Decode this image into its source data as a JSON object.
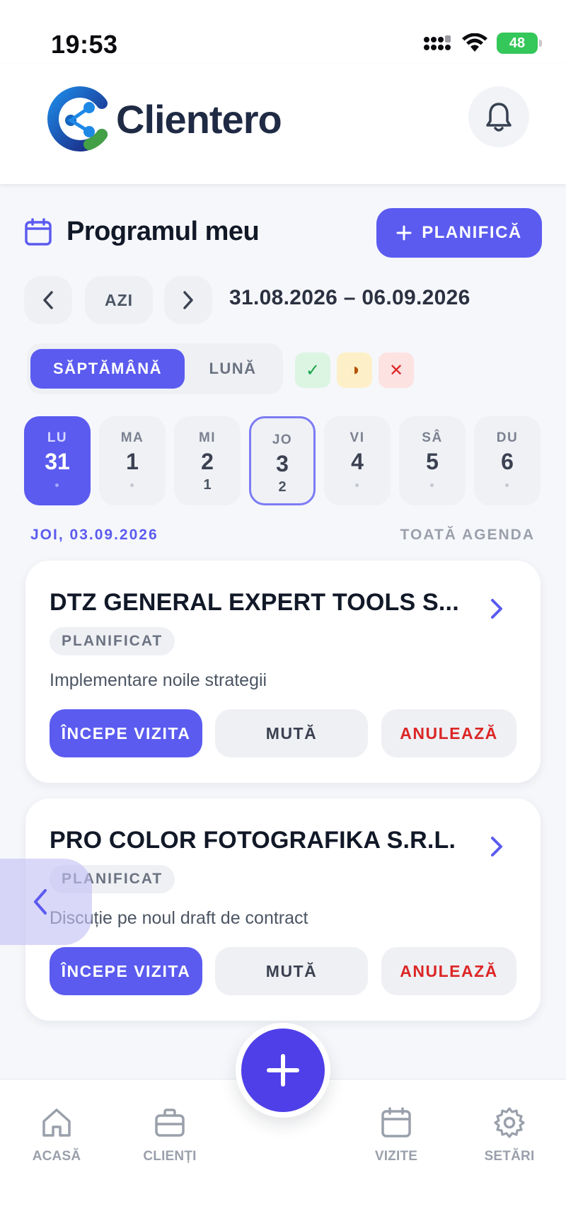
{
  "status_bar": {
    "time": "19:53",
    "battery": "48"
  },
  "header": {
    "app_name": "Clientero"
  },
  "schedule": {
    "title": "Programul meu",
    "plan_button": "PLANIFICĂ",
    "today_button": "AZI",
    "date_range": "31.08.2026 – 06.09.2026",
    "view_week": "SĂPTĂMÂNĂ",
    "view_month": "LUNĂ",
    "filters": {
      "done": "✓",
      "partial": "◑",
      "cancelled": "✕"
    },
    "colors": {
      "accent": "#5b5bf0",
      "fab": "#4f3fe8",
      "danger": "#dc2626",
      "success": "#16a34a"
    }
  },
  "days": [
    {
      "name": "LU",
      "date": "31",
      "count": "",
      "state": "active"
    },
    {
      "name": "MA",
      "date": "1",
      "count": "",
      "state": ""
    },
    {
      "name": "MI",
      "date": "2",
      "count": "1",
      "state": ""
    },
    {
      "name": "JO",
      "date": "3",
      "count": "2",
      "state": "selected"
    },
    {
      "name": "VI",
      "date": "4",
      "count": "",
      "state": ""
    },
    {
      "name": "SÂ",
      "date": "5",
      "count": "",
      "state": ""
    },
    {
      "name": "DU",
      "date": "6",
      "count": "",
      "state": ""
    }
  ],
  "selected_date": "JOI, 03.09.2026",
  "all_agenda": "TOATĂ AGENDA",
  "visits": [
    {
      "client": "DTZ GENERAL EXPERT TOOLS S...",
      "status": "PLANIFICAT",
      "description": "Implementare noile strategii",
      "start": "ÎNCEPE VIZITA",
      "move": "MUTĂ",
      "cancel": "ANULEAZĂ"
    },
    {
      "client": "PRO COLOR FOTOGRAFIKA S.R.L.",
      "status": "PLANIFICAT",
      "description": "Discuție pe noul draft de contract",
      "start": "ÎNCEPE VIZITA",
      "move": "MUTĂ",
      "cancel": "ANULEAZĂ"
    }
  ],
  "bottom_nav": {
    "home": "ACASĂ",
    "clients": "CLIENȚI",
    "visits": "VIZITE",
    "settings": "SETĂRI"
  }
}
